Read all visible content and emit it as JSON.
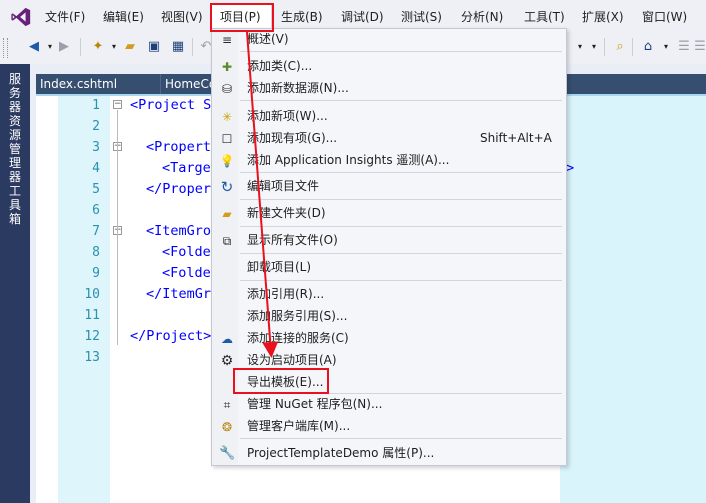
{
  "menu_bar": {
    "items": [
      "文件(F)",
      "编辑(E)",
      "视图(V)",
      "项目(P)",
      "生成(B)",
      "调试(D)",
      "测试(S)",
      "分析(N)",
      "工具(T)",
      "扩展(X)",
      "窗口(W)"
    ]
  },
  "left_strip": {
    "tabs": [
      "服务器资源管理器",
      "工具箱"
    ]
  },
  "document_tabs": [
    "Index.cshtml",
    "HomeCo"
  ],
  "editor": {
    "line_numbers": [
      "1",
      "2",
      "3",
      "4",
      "5",
      "6",
      "7",
      "8",
      "9",
      "10",
      "11",
      "12",
      "13"
    ],
    "lines": [
      "<Project S",
      "",
      "<Propert",
      "<Targe",
      "</Proper",
      "",
      "<ItemGro",
      "<Folde",
      "<Folde",
      "</ItemGr",
      "",
      "</Project>",
      ""
    ]
  },
  "project_menu": {
    "items": [
      {
        "label": "概述(V)",
        "icon": "overview-icon"
      },
      {
        "label": "添加类(C)...",
        "icon": "add-class-icon"
      },
      {
        "label": "添加新数据源(N)...",
        "icon": "add-datasource-icon"
      },
      {
        "label": "添加新项(W)...",
        "icon": "add-new-item-icon"
      },
      {
        "label": "添加现有项(G)...",
        "icon": "add-existing-item-icon",
        "shortcut": "Shift+Alt+A"
      },
      {
        "label": "添加 Application Insights 遥测(A)...",
        "icon": "app-insights-icon"
      },
      {
        "label": "编辑项目文件",
        "icon": "edit-project-icon"
      },
      {
        "label": "新建文件夹(D)",
        "icon": "new-folder-icon"
      },
      {
        "label": "显示所有文件(O)",
        "icon": "show-all-files-icon"
      },
      {
        "label": "卸载项目(L)",
        "icon": ""
      },
      {
        "label": "添加引用(R)...",
        "icon": ""
      },
      {
        "label": "添加服务引用(S)...",
        "icon": ""
      },
      {
        "label": "添加连接的服务(C)",
        "icon": "connected-service-icon"
      },
      {
        "label": "设为启动项目(A)",
        "icon": "gear-icon"
      },
      {
        "label": "导出模板(E)...",
        "icon": ""
      },
      {
        "label": "管理 NuGet 程序包(N)...",
        "icon": "nuget-icon"
      },
      {
        "label": "管理客户端库(M)...",
        "icon": "client-library-icon"
      },
      {
        "label": "ProjectTemplateDemo 属性(P)...",
        "icon": "wrench-icon"
      }
    ]
  },
  "colors": {
    "highlight": "#e8121f",
    "vs_purple": "#68217a",
    "left_strip": "#2b3a60",
    "tab_row": "#364e6f"
  }
}
